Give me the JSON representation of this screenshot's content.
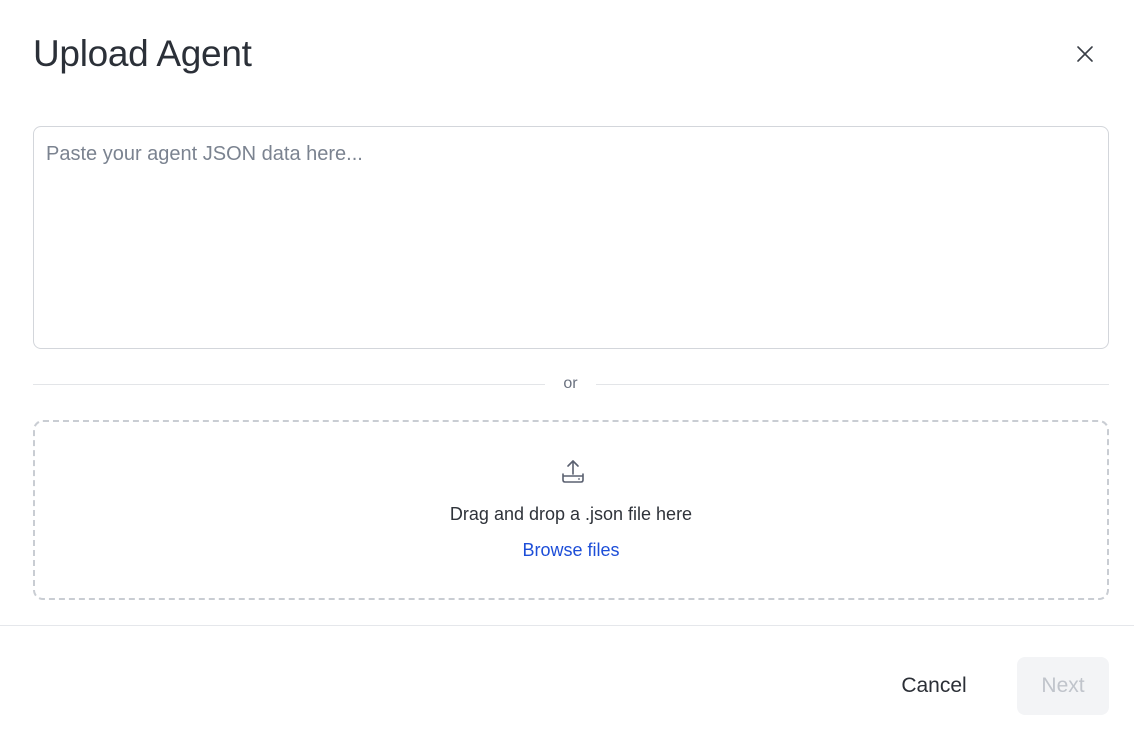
{
  "dialog": {
    "title": "Upload Agent",
    "close_icon": "close-icon"
  },
  "json_input": {
    "value": "",
    "placeholder": "Paste your agent JSON data here..."
  },
  "divider": {
    "label": "or"
  },
  "dropzone": {
    "icon": "upload-icon",
    "text": "Drag and drop a .json file here",
    "browse_label": "Browse files"
  },
  "footer": {
    "cancel_label": "Cancel",
    "next_label": "Next",
    "next_disabled": true
  },
  "colors": {
    "link": "#1d4ed8",
    "border": "#d3d6db",
    "disabled_bg": "#f3f4f6",
    "disabled_text": "#c0c4cb"
  }
}
